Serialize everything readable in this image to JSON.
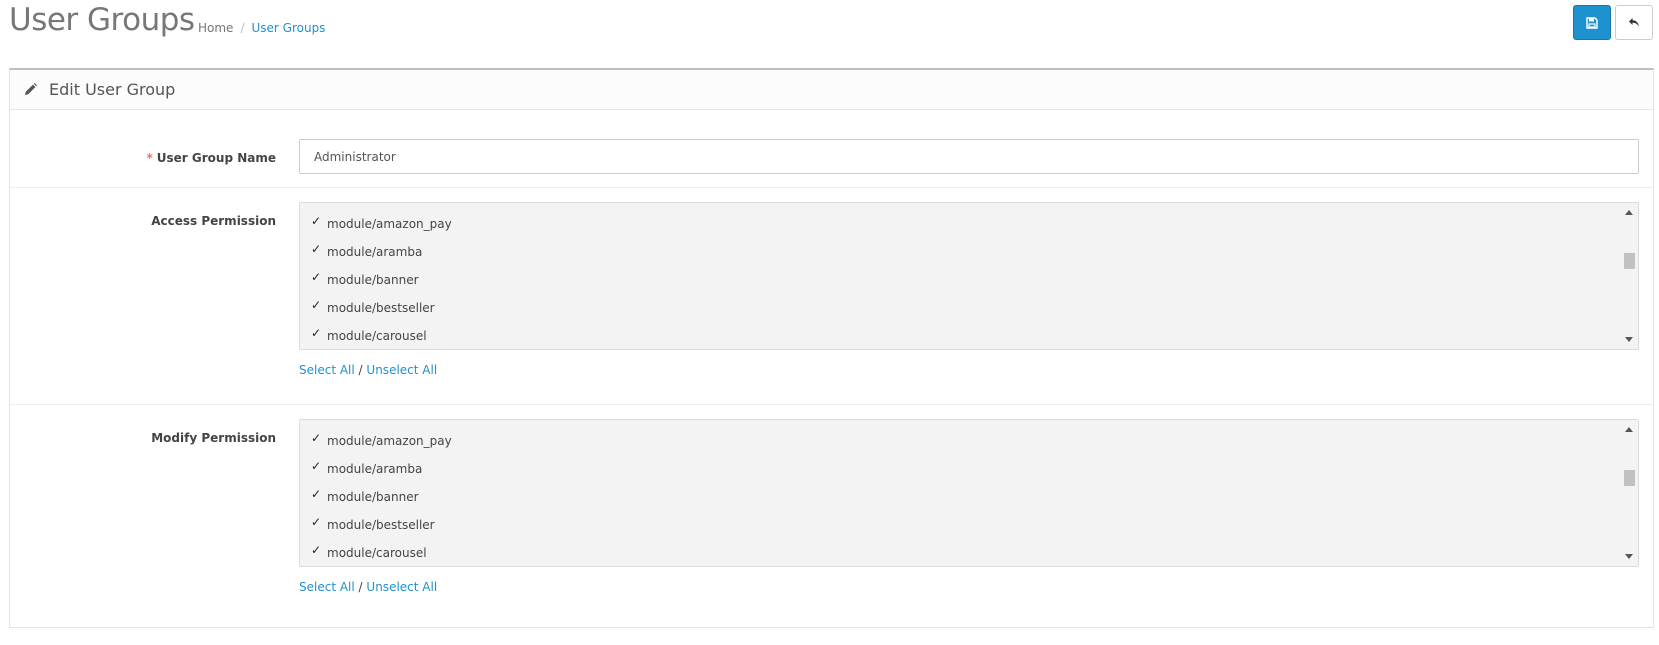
{
  "header": {
    "title": "User Groups",
    "breadcrumb": {
      "home": "Home",
      "separator": "/",
      "current": "User Groups"
    },
    "save_icon": "floppy-disk-icon",
    "back_icon": "reply-arrow-icon"
  },
  "panel": {
    "heading_icon": "pencil-icon",
    "title": "Edit User Group"
  },
  "form": {
    "name": {
      "required_marker": "*",
      "label": "User Group Name",
      "value": "Administrator"
    },
    "access": {
      "label": "Access Permission",
      "items": [
        {
          "label": "module/amazon_pay",
          "checked": true
        },
        {
          "label": "module/aramba",
          "checked": true
        },
        {
          "label": "module/banner",
          "checked": true
        },
        {
          "label": "module/bestseller",
          "checked": true
        },
        {
          "label": "module/carousel",
          "checked": true
        }
      ],
      "select_all": "Select All",
      "divider": "/",
      "unselect_all": "Unselect All"
    },
    "modify": {
      "label": "Modify Permission",
      "items": [
        {
          "label": "module/amazon_pay",
          "checked": true
        },
        {
          "label": "module/aramba",
          "checked": true
        },
        {
          "label": "module/banner",
          "checked": true
        },
        {
          "label": "module/bestseller",
          "checked": true
        },
        {
          "label": "module/carousel",
          "checked": true
        }
      ],
      "select_all": "Select All",
      "divider": "/",
      "unselect_all": "Unselect All"
    }
  },
  "colors": {
    "primary": "#1e91cf",
    "required": "#f56b6b"
  }
}
